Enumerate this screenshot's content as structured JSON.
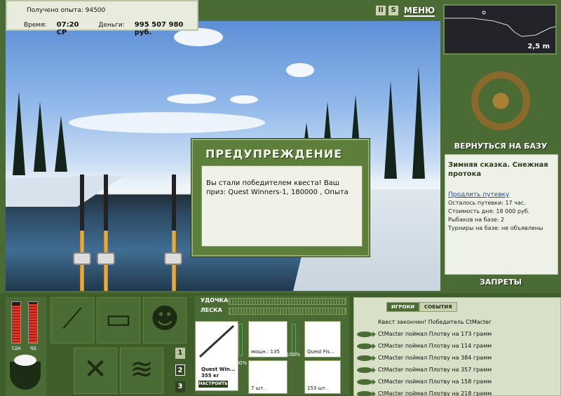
{
  "top_info": {
    "experience_label": "Получено опыта:",
    "experience_value": "94500",
    "time_label": "Время:",
    "time_value": "07:20 СР",
    "money_label": "Деньги:",
    "money_value": "995 507 980 руб."
  },
  "top_buttons": {
    "pause": "II",
    "s_button": "S",
    "menu": "МЕНЮ"
  },
  "depth_map": {
    "depth": "2,5 m"
  },
  "right_panel": {
    "back_to_base": "ВЕРНУТЬСЯ НА БАЗУ",
    "location_title": "Зимняя сказка. Снежная протока",
    "extend_trip": "Продлить путевку",
    "lines": [
      "Осталось путевки: 17 час.",
      "Стоимость дня: 18 000 руб.",
      "Рыбаков на базе: 2",
      "Турниры на базе: не объявлены"
    ],
    "bans": "ЗАПРЕТЫ"
  },
  "dialog": {
    "title": "ПРЕДУПРЕЖДЕНИЕ",
    "message": "Вы стали победителем квеста! Ваш приз: Quest Winners-1, 180000 , Опыта"
  },
  "meters": {
    "food_label": "ЕДА",
    "poison_label": "ЯД",
    "food_level": 0.92,
    "poison_level": 0.95
  },
  "tackle": {
    "rod_label": "УДОЧКА",
    "line_label": "ЛЕСКА",
    "rod_name": "Quest Win...",
    "rod_weight": "355 кг",
    "rod_pct": "100%",
    "setup_button": "НАСТРОИТЬ",
    "reel_text": "мощн.: 135",
    "reel_pct": "100%",
    "line_item": "Quest Fis...",
    "hook_count": "7 шт.",
    "bait_count": "153 шт."
  },
  "slot_numbers": [
    "1",
    "2",
    "3"
  ],
  "events": {
    "tab_players": "ИГРОКИ",
    "tab_events": "СОБЫТИЯ",
    "items": [
      "Квест закончен! Победитель CtMacter",
      "CtMacter поймал Плотву на 173 грамм",
      "CtMacter поймал Плотву на 114 грамм",
      "CtMacter поймал Плотву на 384 грамм",
      "CtMacter поймал Плотву на 357 грамм",
      "CtMacter поймал Плотву на 158 грамм",
      "CtMacter поймал Плотву на 218 грамм"
    ]
  },
  "colors": {
    "panel_green": "#4a6b33",
    "dark_green": "#3f5e2a",
    "accent_red": "#d23a2a"
  }
}
